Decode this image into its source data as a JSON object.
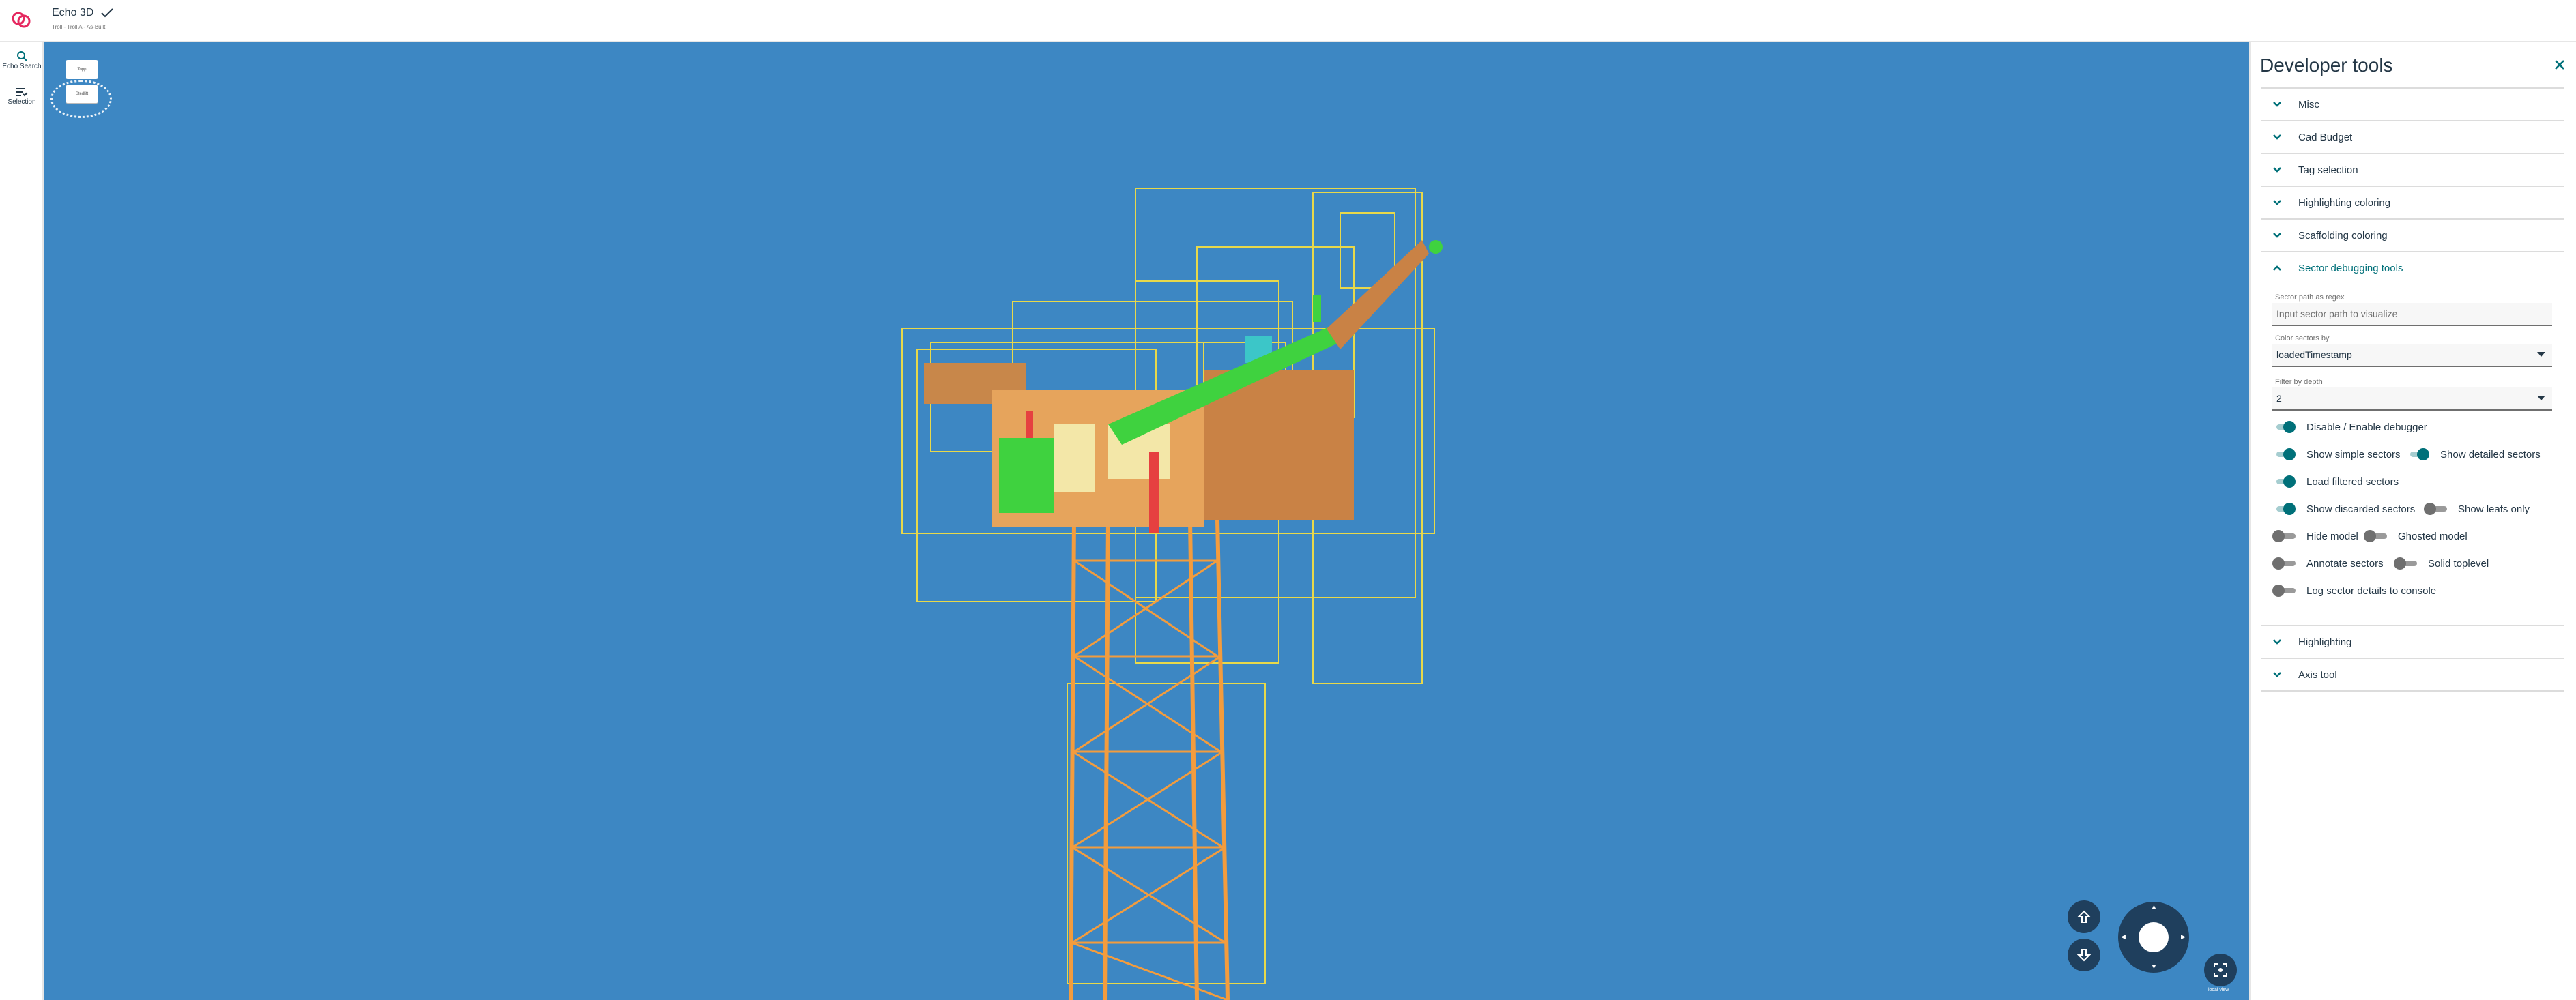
{
  "header": {
    "title": "Echo 3D",
    "subtitle": "Troll - Troll A - As-Built",
    "logo_color": "#e5285f"
  },
  "sidebar": {
    "items": [
      {
        "label": "Echo Search",
        "icon": "search-icon"
      },
      {
        "label": "Selection",
        "icon": "selection-list-icon"
      }
    ]
  },
  "viewport": {
    "background": "#3d87c3",
    "plant_toggle_top": "Topp",
    "plant_toggle_bottom": "Stedlift",
    "fit_label": "local view"
  },
  "panel": {
    "title": "Developer tools",
    "sections": [
      {
        "label": "Misc",
        "expanded": false
      },
      {
        "label": "Cad Budget",
        "expanded": false
      },
      {
        "label": "Tag selection",
        "expanded": false
      },
      {
        "label": "Highlighting coloring",
        "expanded": false
      },
      {
        "label": "Scaffolding coloring",
        "expanded": false
      },
      {
        "label": "Sector debugging tools",
        "expanded": true
      }
    ],
    "after_sections": [
      {
        "label": "Highlighting",
        "expanded": false
      },
      {
        "label": "Axis tool",
        "expanded": false
      }
    ],
    "sector_tools": {
      "path_label": "Sector path as regex",
      "path_placeholder": "Input sector path to visualize",
      "color_label": "Color sectors by",
      "color_value": "loadedTimestamp",
      "depth_label": "Filter by depth",
      "depth_value": "2",
      "switches": {
        "disable_enable": {
          "label": "Disable / Enable debugger",
          "on": true
        },
        "show_simple": {
          "label": "Show simple sectors",
          "on": true
        },
        "show_detailed": {
          "label": "Show detailed sectors",
          "on": true
        },
        "load_filtered": {
          "label": "Load filtered sectors",
          "on": true
        },
        "show_discarded": {
          "label": "Show discarded sectors",
          "on": true
        },
        "show_leafs": {
          "label": "Show leafs only",
          "on": false
        },
        "hide_model": {
          "label": "Hide model",
          "on": false
        },
        "ghosted_model": {
          "label": "Ghosted model",
          "on": false
        },
        "annotate": {
          "label": "Annotate sectors",
          "on": false
        },
        "solid_toplevel": {
          "label": "Solid toplevel",
          "on": false
        },
        "log_details": {
          "label": "Log sector details to console",
          "on": false
        }
      }
    },
    "accent": "#007079"
  }
}
